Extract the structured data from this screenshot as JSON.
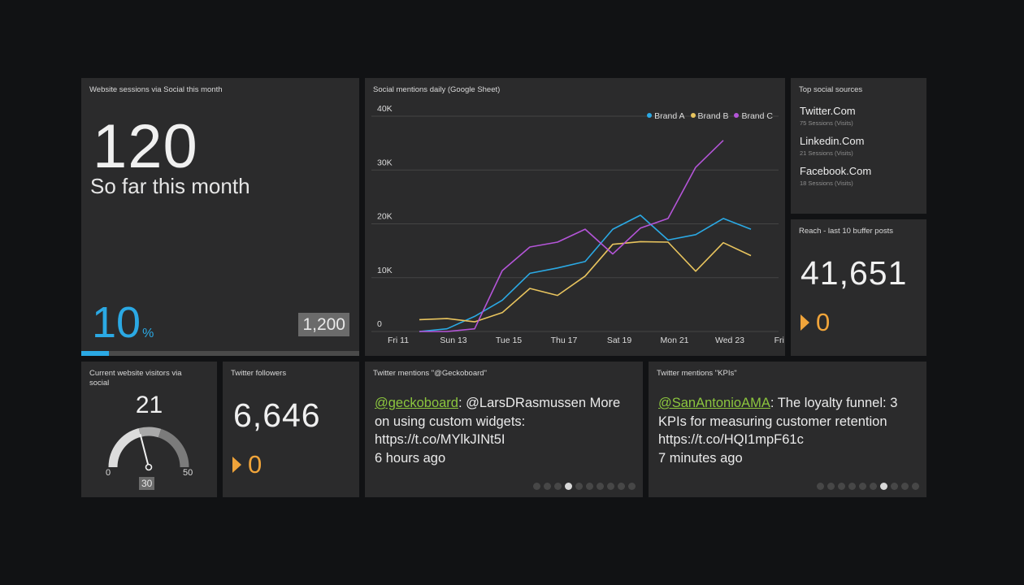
{
  "sessions": {
    "title": "Website sessions via Social this month",
    "value": "120",
    "subtitle": "So far this month",
    "percent": "10",
    "percent_unit": "%",
    "goal": "1,200",
    "progress_fraction": 0.1,
    "accent_color": "#2ba9e4"
  },
  "mentions_chart": {
    "title": "Social mentions daily (Google Sheet)"
  },
  "chart_data": {
    "type": "line",
    "title": "Social mentions daily (Google Sheet)",
    "xlabel": "",
    "ylabel": "",
    "x": [
      "Fri 11",
      "Sat 12",
      "Sun 13",
      "Mon 14",
      "Tue 15",
      "Wed 16",
      "Thu 17",
      "Fri 18",
      "Sat 19",
      "Sun 20",
      "Mon 21",
      "Tue 22",
      "Wed 23",
      "Thu 24",
      "Fri 25"
    ],
    "x_tick_labels": [
      "Fri 11",
      "Sun 13",
      "Tue 15",
      "Thu 17",
      "Sat 19",
      "Mon 21",
      "Wed 23",
      "Fri 25"
    ],
    "y_tick_labels": [
      "0",
      "10K",
      "20K",
      "30K",
      "40K"
    ],
    "ylim": [
      0,
      40000
    ],
    "grid": true,
    "legend_position": "top-right",
    "series": [
      {
        "name": "Brand A",
        "color": "#2ba9e4",
        "values": [
          null,
          0,
          500,
          2800,
          5800,
          10800,
          11800,
          13000,
          19000,
          21600,
          17000,
          18000,
          21000,
          19000,
          null
        ]
      },
      {
        "name": "Brand B",
        "color": "#e8c45e",
        "values": [
          null,
          2200,
          2400,
          1800,
          3500,
          8000,
          6700,
          10300,
          16200,
          16700,
          16600,
          11200,
          16500,
          14100,
          null
        ]
      },
      {
        "name": "Brand C",
        "color": "#b455d8",
        "values": [
          null,
          0,
          0,
          500,
          11300,
          15700,
          16600,
          19000,
          14400,
          19200,
          21000,
          30500,
          35500,
          null,
          null
        ]
      }
    ]
  },
  "top_sources": {
    "title": "Top social sources",
    "items": [
      {
        "name": "Twitter.Com",
        "meta": "75 Sessions (Visits)"
      },
      {
        "name": "Linkedin.Com",
        "meta": "21 Sessions (Visits)"
      },
      {
        "name": "Facebook.Com",
        "meta": "18 Sessions (Visits)"
      }
    ]
  },
  "reach": {
    "title": "Reach - last 10 buffer posts",
    "value": "41,651",
    "change": "0",
    "change_color": "#f0a43a"
  },
  "visitors": {
    "title": "Current website visitors via social",
    "value": "21",
    "min": "0",
    "max": "50",
    "goal": "30",
    "level_fraction": 0.42
  },
  "followers": {
    "title": "Twitter followers",
    "value": "6,646",
    "change": "0"
  },
  "tweet1": {
    "title": "Twitter mentions \"@Geckoboard\"",
    "handle": "@geckoboard",
    "text": ": @LarsDRasmussen More on using custom widgets: https://t.co/MYlkJINt5I",
    "time": "6 hours ago",
    "page_count": 10,
    "active_page": 4
  },
  "tweet2": {
    "title": "Twitter mentions \"KPIs\"",
    "handle": "@SanAntonioAMA",
    "text": ": The loyalty funnel: 3 KPIs for measuring customer retention https://t.co/HQI1mpF61c",
    "time": "7 minutes ago",
    "page_count": 10,
    "active_page": 7
  }
}
